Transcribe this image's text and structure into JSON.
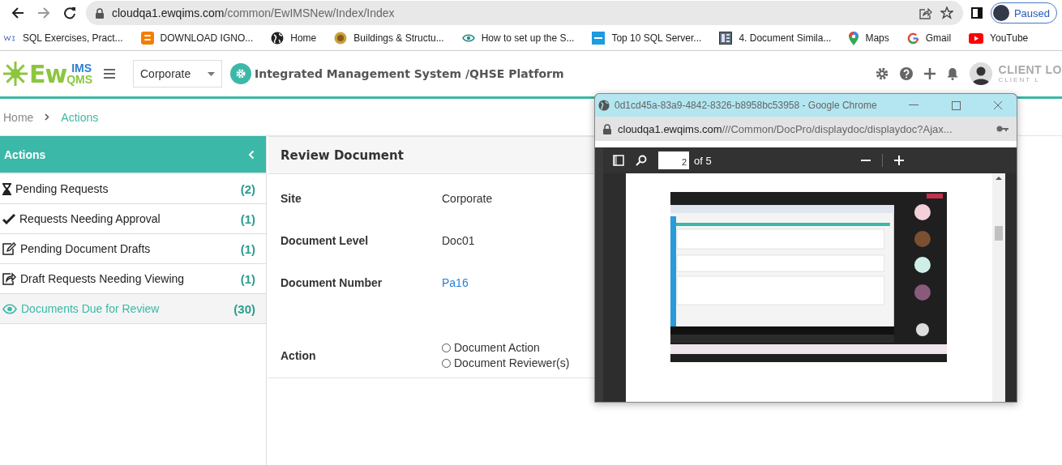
{
  "browser": {
    "url_host": "cloudqa1.ewqims.com",
    "url_path": "/common/EwIMSNew/Index/Index",
    "profile": "Paused",
    "bookmarks": [
      {
        "kind": "w3r",
        "label": "SQL Exercises, Pract..."
      },
      {
        "kind": "blogger",
        "label": "DOWNLOAD IGNO..."
      },
      {
        "kind": "globe",
        "label": "Home"
      },
      {
        "kind": "buildings",
        "label": "Buildings & Structu..."
      },
      {
        "kind": "eye",
        "label": "How to set up the S..."
      },
      {
        "kind": "itpro",
        "label": "Top 10 SQL Server..."
      },
      {
        "kind": "doc",
        "label": "4. Document Simila..."
      },
      {
        "kind": "maps",
        "label": "Maps"
      },
      {
        "kind": "gmail",
        "label": "Gmail"
      },
      {
        "kind": "youtube",
        "label": "YouTube"
      }
    ]
  },
  "header": {
    "logo_main": "Ew",
    "logo_top": "IMS",
    "logo_bottom": "QMS",
    "site": "Corporate",
    "title": "Integrated Management System /QHSE Platform",
    "client_logo": "CLIENT LO",
    "client_logo_sub": "CLIENT L"
  },
  "breadcrumb": [
    {
      "label": "Home",
      "selected": false
    },
    {
      "label": "Actions",
      "selected": true
    }
  ],
  "sidebar": {
    "title": "Actions",
    "items": [
      {
        "kind": "hourglass",
        "label": "Pending Requests",
        "count": "(2)",
        "selected": false
      },
      {
        "kind": "check",
        "label": "Requests Needing Approval",
        "count": "(1)",
        "selected": false
      },
      {
        "kind": "edit",
        "label": "Pending Document Drafts",
        "count": "(1)",
        "selected": false
      },
      {
        "kind": "share",
        "label": "Draft Requests Needing Viewing",
        "count": "(1)",
        "selected": false
      },
      {
        "kind": "eye",
        "label": "Documents Due for Review",
        "count": "(30)",
        "selected": true
      }
    ]
  },
  "panel": {
    "title": "Review Document",
    "fields": [
      {
        "label": "Site",
        "value": "Corporate",
        "kind": "text"
      },
      {
        "label": "Document Level",
        "value": "Doc01",
        "kind": "text"
      },
      {
        "label": "Document Number",
        "value": "Pa16",
        "kind": "link"
      }
    ],
    "action": {
      "label": "Action",
      "options": [
        {
          "label": "Document Action",
          "selected": false
        },
        {
          "label": "Document Reviewer(s)",
          "selected": false
        }
      ]
    }
  },
  "popup": {
    "title": "0d1cd45a-83a9-4842-8326-b8958bc53958 - Google Chrome",
    "url_host": "cloudqa1.ewqims.com",
    "url_path": "///Common/DocPro/displaydoc/displaydoc?Ajax...",
    "page": "2",
    "page_total": "of 5"
  }
}
